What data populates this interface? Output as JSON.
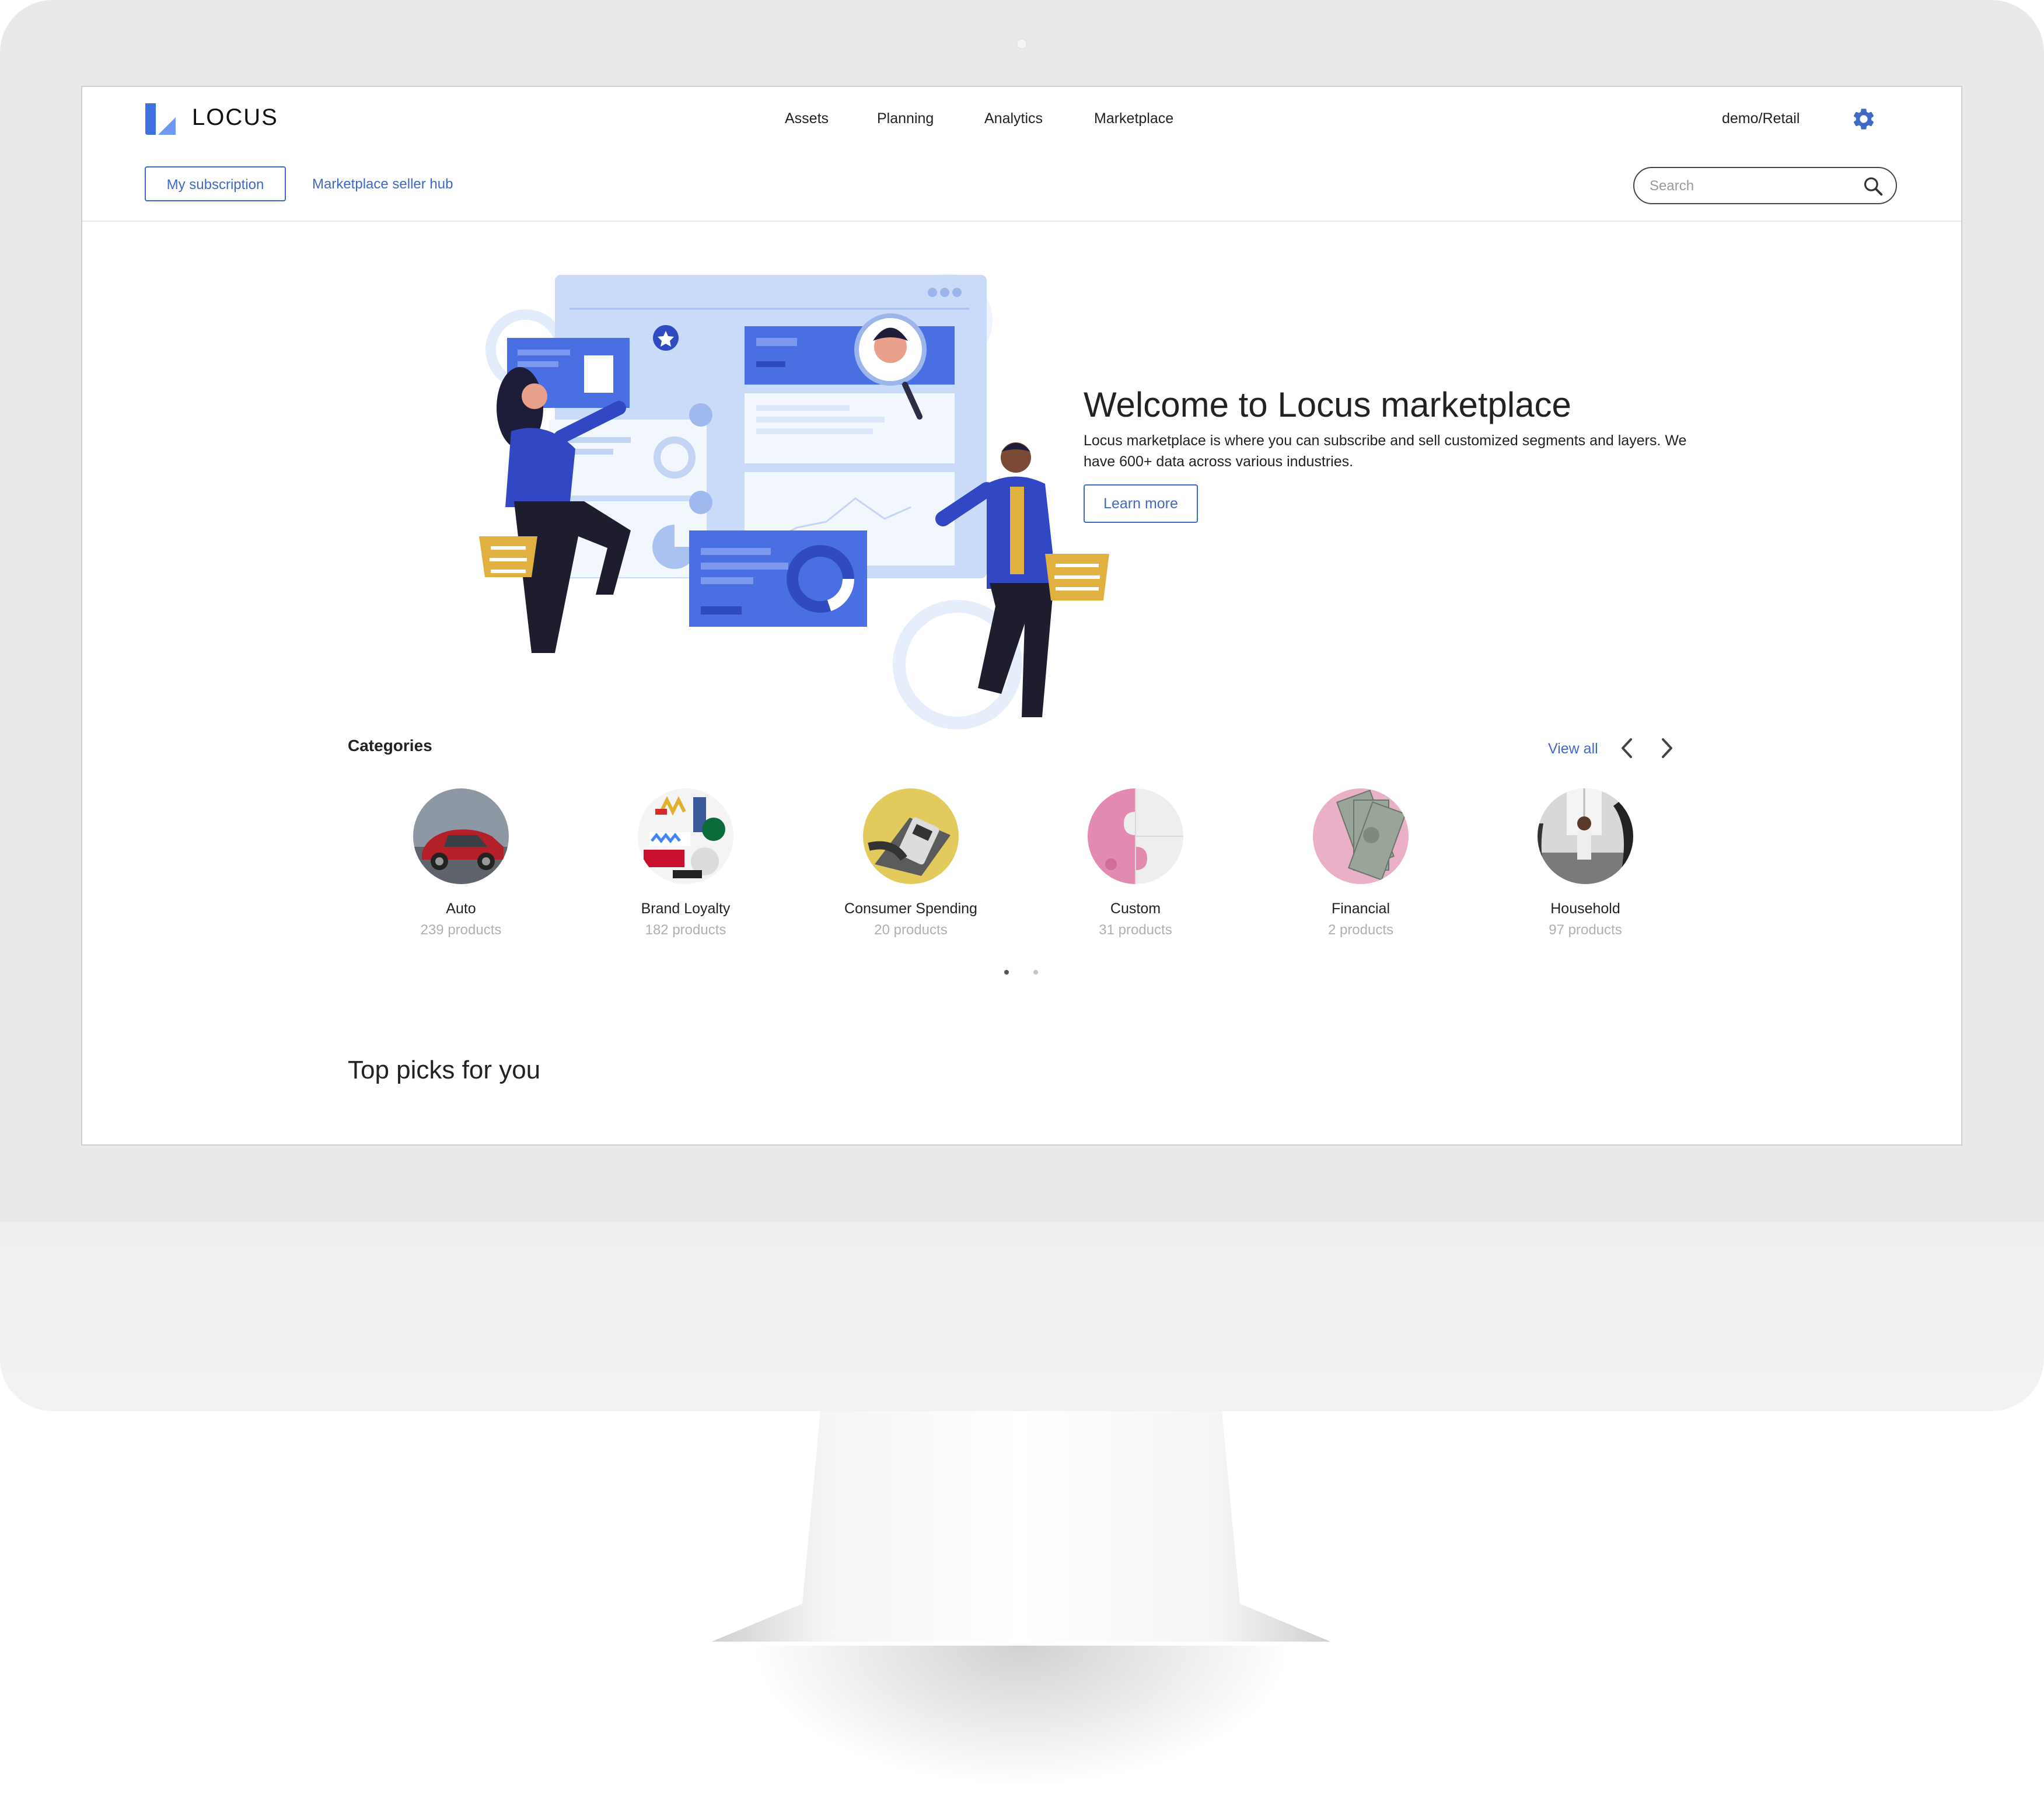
{
  "brand": {
    "name": "LOCUS",
    "accent": "#3f69c4",
    "logo_color": "#4a78e0"
  },
  "topnav": {
    "items": [
      "Assets",
      "Planning",
      "Analytics",
      "Marketplace"
    ],
    "account": "demo/Retail",
    "settings_icon": "gear-icon"
  },
  "subnav": {
    "subscription_label": "My subscription",
    "seller_hub_label": "Marketplace seller hub",
    "search_placeholder": "Search"
  },
  "hero": {
    "title": "Welcome to Locus marketplace",
    "description": "Locus marketplace is where you can subscribe and sell customized segments and layers. We have 600+ data across various industries.",
    "button_label": "Learn more"
  },
  "categories": {
    "title": "Categories",
    "view_all": "View all",
    "items": [
      {
        "name": "Auto",
        "count": "239 products"
      },
      {
        "name": "Brand Loyalty",
        "count": "182 products"
      },
      {
        "name": "Consumer Spending",
        "count": "20 products"
      },
      {
        "name": "Custom",
        "count": "31 products"
      },
      {
        "name": "Financial",
        "count": "2 products"
      },
      {
        "name": "Household",
        "count": "97 products"
      }
    ],
    "pages": 2,
    "current_page": 1
  },
  "top_picks": {
    "title": "Top picks for you"
  }
}
